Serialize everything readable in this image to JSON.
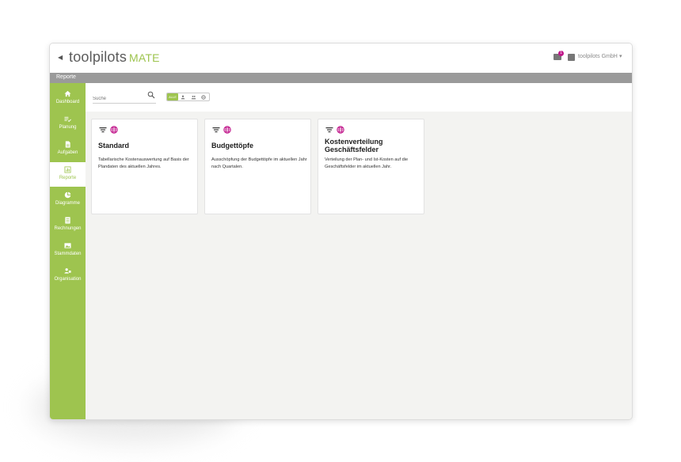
{
  "header": {
    "logo_main": "toolpilots",
    "logo_sub": "MATE",
    "mail_badge_count": "1",
    "company_name": "toolpilots GmbH"
  },
  "breadcrumb": "Reporte",
  "sidebar": {
    "items": [
      {
        "label": "Dashboard",
        "icon": "home-icon"
      },
      {
        "label": "Planung",
        "icon": "list-check-icon"
      },
      {
        "label": "Aufgaben",
        "icon": "document-icon"
      },
      {
        "label": "Reporte",
        "icon": "report-icon",
        "active": true
      },
      {
        "label": "Diagramme",
        "icon": "pie-chart-icon"
      },
      {
        "label": "Rechnungen",
        "icon": "invoice-icon"
      },
      {
        "label": "Stammdaten",
        "icon": "image-icon"
      },
      {
        "label": "Organisation",
        "icon": "people-icon"
      }
    ]
  },
  "toolbar": {
    "search_placeholder": "Suche",
    "filter_all_label": "ALLE"
  },
  "cards": [
    {
      "title": "Standard",
      "description": "Tabellarische Kostenauswertung auf Basis der Plandaten des aktuellen Jahres."
    },
    {
      "title": "Budgettöpfe",
      "description": "Ausschöpfung der Budgettöpfe im aktuellen Jahr nach Quartalen."
    },
    {
      "title": "Kostenverteilung Geschäftsfelder",
      "description": "Verteilung der Plan- und Ist-Kosten auf die Geschäftsfelder im aktuellen Jahr."
    }
  ],
  "colors": {
    "accent_green": "#9ec44f",
    "accent_magenta": "#c0168a",
    "breadcrumb_gray": "#9a9a9a"
  }
}
